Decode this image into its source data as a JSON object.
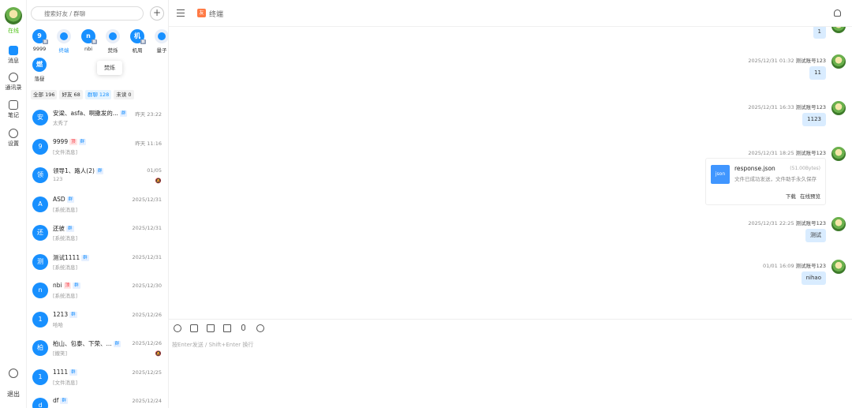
{
  "rail": {
    "status": "在线",
    "items": [
      {
        "label": "消息",
        "icon": "chat-icon"
      },
      {
        "label": "通讯录",
        "icon": "contacts-icon"
      },
      {
        "label": "笔记",
        "icon": "notebook-icon"
      },
      {
        "label": "设置",
        "icon": "gear-icon"
      }
    ],
    "bottom": {
      "label": "退出",
      "icon": "logout-icon"
    }
  },
  "search": {
    "placeholder": "搜索好友 / 群聊"
  },
  "pinned": [
    {
      "initial": "9",
      "name": "9999"
    },
    {
      "initial": "",
      "name": "终端"
    },
    {
      "initial": "n",
      "name": "nbi"
    },
    {
      "initial": "",
      "name": "焚烁"
    },
    {
      "initial": "机",
      "name": "机周"
    },
    {
      "initial": "",
      "name": "量子"
    },
    {
      "initial": "燃",
      "name": "落昼"
    }
  ],
  "tooltip": "焚烁",
  "filters": [
    "全部 196",
    "好友 68",
    "群聊 128",
    "未读 0"
  ],
  "conversations": [
    {
      "initial": "安",
      "name": "安梁、asfa、啊撒发的...",
      "tags": [
        "群"
      ],
      "msg": "太秀了",
      "time": "昨天 23:22"
    },
    {
      "initial": "9",
      "name": "9999",
      "tags": [
        "顶",
        "群"
      ],
      "msg": "[文件消息]",
      "time": "昨天 11:16"
    },
    {
      "initial": "领",
      "name": "领导1、路人(2)",
      "tags": [
        "群"
      ],
      "msg": "123",
      "time": "01/05",
      "muted": true
    },
    {
      "initial": "A",
      "name": "ASD",
      "tags": [
        "群"
      ],
      "msg": "[系统消息]",
      "time": "2025/12/31"
    },
    {
      "initial": "还",
      "name": "还彼",
      "tags": [
        "群"
      ],
      "msg": "[系统消息]",
      "time": "2025/12/31"
    },
    {
      "initial": "测",
      "name": "测试1111",
      "tags": [
        "群"
      ],
      "msg": "[系统消息]",
      "time": "2025/12/31"
    },
    {
      "initial": "n",
      "name": "nbi",
      "tags": [
        "顶",
        "群"
      ],
      "msg": "[系统消息]",
      "time": "2025/12/30"
    },
    {
      "initial": "1",
      "name": "1213",
      "tags": [
        "群"
      ],
      "msg": "哈哈",
      "time": "2025/12/26"
    },
    {
      "initial": "柏",
      "name": "柏山、包泰、下荣、...",
      "tags": [
        "群"
      ],
      "msg": "[撤笑]",
      "time": "2025/12/26",
      "muted": true
    },
    {
      "initial": "1",
      "name": "1111",
      "tags": [
        "群"
      ],
      "msg": "[文件消息]",
      "time": "2025/12/25"
    },
    {
      "initial": "d",
      "name": "df",
      "tags": [
        "群"
      ],
      "msg": "",
      "time": "2025/12/24"
    }
  ],
  "chat": {
    "title": "终端",
    "avatar_text": "友",
    "messages": [
      {
        "type": "text",
        "meta": "",
        "sender": "",
        "text": "1"
      },
      {
        "type": "text",
        "meta": "2025/12/31 01:32",
        "sender": "测试账号123",
        "text": "11"
      },
      {
        "type": "text",
        "meta": "2025/12/31 16:33",
        "sender": "测试账号123",
        "text": "1123"
      },
      {
        "type": "file",
        "meta": "2025/12/31 18:25",
        "sender": "测试账号123",
        "file": {
          "icon_text": "json",
          "name": "response.json",
          "size": "(51.00Bytes)",
          "note": "文件已成功发送，文件助手永久保存",
          "actions": [
            "下载",
            "在线预览"
          ]
        }
      },
      {
        "type": "text",
        "meta": "2025/12/31 22:25",
        "sender": "测试账号123",
        "text": "测试"
      },
      {
        "type": "text",
        "meta": "01/01 16:09",
        "sender": "测试账号123",
        "text": "nihao"
      }
    ],
    "input_placeholder": "按Enter发送 / Shift+Enter 换行"
  }
}
